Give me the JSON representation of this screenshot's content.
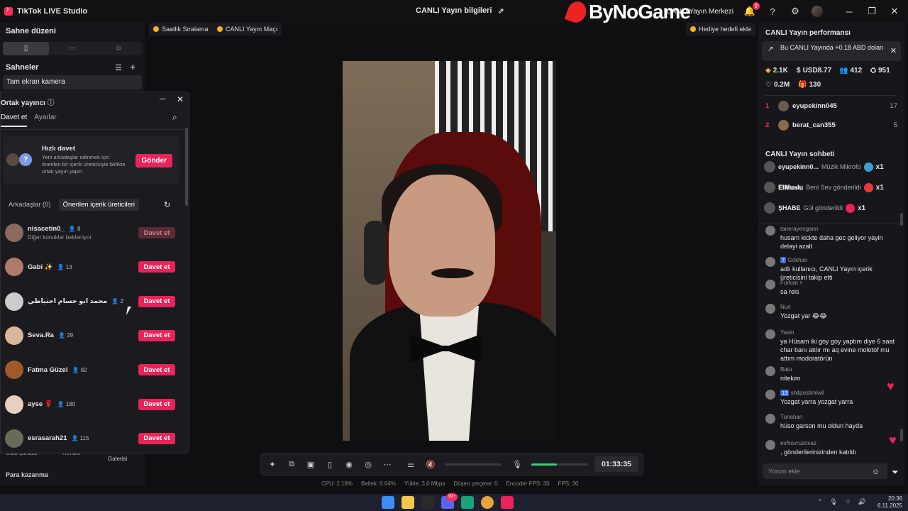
{
  "window": {
    "app_title": "TikTok LIVE Studio",
    "center_title": "CANLI Yayın bilgileri",
    "live_center": "CANLI Yayın Merkezi",
    "notif_count": "9",
    "watermark": "ByNoGame"
  },
  "left": {
    "stage_layout": "Sahne düzeni",
    "scenes_title": "Sahneler",
    "scene_item": "Tam ekran kamera",
    "partial_items": [
      "Ödül çarkası",
      "Rehber",
      "Galerisi"
    ],
    "earn": "Para kazanma"
  },
  "cohost": {
    "title": "Ortak yayıncı",
    "tabs": [
      "Davet et",
      "Ayarlar"
    ],
    "quick_invite_title": "Hızlı davet",
    "quick_invite_desc": "Yeni arkadaşlar edinmek için önerilen bir içerik üreticisiyle birlikte ortak yayın yapın",
    "send_label": "Gönder",
    "subtabs": [
      "Arkadaşlar (0)",
      "Önerilen içerik üreticileri"
    ],
    "invite_label": "Davet et",
    "friends": [
      {
        "name": "nisacetin0_",
        "count": "8",
        "sub": "Diğer konuklar bekleniyor",
        "disabled": true,
        "color": "#8a6a5c"
      },
      {
        "name": "Gabi ✨",
        "count": "13",
        "sub": "",
        "disabled": false,
        "color": "#b07a6a"
      },
      {
        "name": "محمد ابو حسام احتياطي",
        "count": "2",
        "sub": "",
        "disabled": false,
        "color": "#ccc"
      },
      {
        "name": "Seva.Ra",
        "count": "29",
        "sub": "",
        "disabled": false,
        "color": "#d8b89a"
      },
      {
        "name": "Fatma Güzel",
        "count": "82",
        "sub": "",
        "disabled": false,
        "color": "#a05a2a"
      },
      {
        "name": "ayse 🌹",
        "count": "180",
        "sub": "",
        "disabled": false,
        "color": "#e8d0c0"
      },
      {
        "name": "esrasarah21",
        "count": "115",
        "sub": "",
        "disabled": false,
        "color": "#6a6a5a"
      }
    ]
  },
  "chips": {
    "hourly": "Saatlik Sıralama",
    "match": "CANLI Yayın Maçı",
    "gift_goal": "Hediye hedefi ekle"
  },
  "controls": {
    "timer": "01:33:35",
    "mic_level": 0.45,
    "stats": [
      "CPU: 2.16%",
      "Bellek: 0.64%",
      "Yükle: 3.0 Mbps",
      "Düşen çerçeve: 0",
      "Encoder FPS: 30",
      "FPS: 30"
    ]
  },
  "right": {
    "perf_title": "CANLI Yayın performansı",
    "notice": "Bu CANLI Yayında +0.18 ABD doları",
    "kpis": {
      "diamonds": "2.1K",
      "usd": "USD8.77",
      "viewers": "412",
      "total_viewers": "951",
      "likes": "0.2M",
      "gifters": "130"
    },
    "ranking": [
      {
        "rank": "1",
        "name": "eyupekinn045",
        "value": "17"
      },
      {
        "rank": "2",
        "name": "berat_can355",
        "value": "5"
      }
    ],
    "chat_title": "CANLI Yayın sohbeti",
    "gifts": [
      {
        "user": "eyupekinn0...",
        "text": "Müzik Mikrofo",
        "mult": "x1",
        "color": "#3aa0d8"
      },
      {
        "user": "𝐄𝐈𝐌𝐮𝐬𝐥𝐮",
        "text": "Beni Sev gönderildi",
        "mult": "x1",
        "color": "#e83a3a"
      },
      {
        "user": "ŞHABE",
        "text": "Gül gönderildi",
        "mult": "x1",
        "color": "#e8245a"
      }
    ],
    "messages": [
      {
        "user": "tanerayeogann",
        "level": "",
        "text": "husam kickte daha gec geliyor yayin delayi azalt"
      },
      {
        "user": "Gökhan",
        "level": "7",
        "text": "adlı kullanıcı, CANLI Yayın içerik üreticisini takip etti"
      },
      {
        "user": "Furkan ☓",
        "level": "",
        "text": "sa reis"
      },
      {
        "user": "Nuri",
        "level": "",
        "text": "Yozgat yar 😂😂"
      },
      {
        "user": "Yasin",
        "level": "",
        "text": "ya Hüsam iki goy goy yaptım diye 6 saat char banı atılır mı aq evine molotof mu attım modoratörün"
      },
      {
        "user": "Batu",
        "level": "",
        "text": "nitekim"
      },
      {
        "user": "shitpostimiwil",
        "level": "13",
        "text": "Yozgat yarra yozgat yarra"
      },
      {
        "user": "Tunahan",
        "level": "",
        "text": "hüso garson mu oldun hayda"
      },
      {
        "user": "ʀᴜNovruzovaz",
        "level": "",
        "text": ", gönderilerinizinden katıldı"
      }
    ],
    "comment_placeholder": "Yorum ekle"
  },
  "taskbar": {
    "time": "20:36",
    "date": "6.11.2025",
    "discord_badge": "99+"
  },
  "colors": {
    "accent": "#fe2c55",
    "invite": "#e8245a",
    "mic": "#33d17a"
  }
}
